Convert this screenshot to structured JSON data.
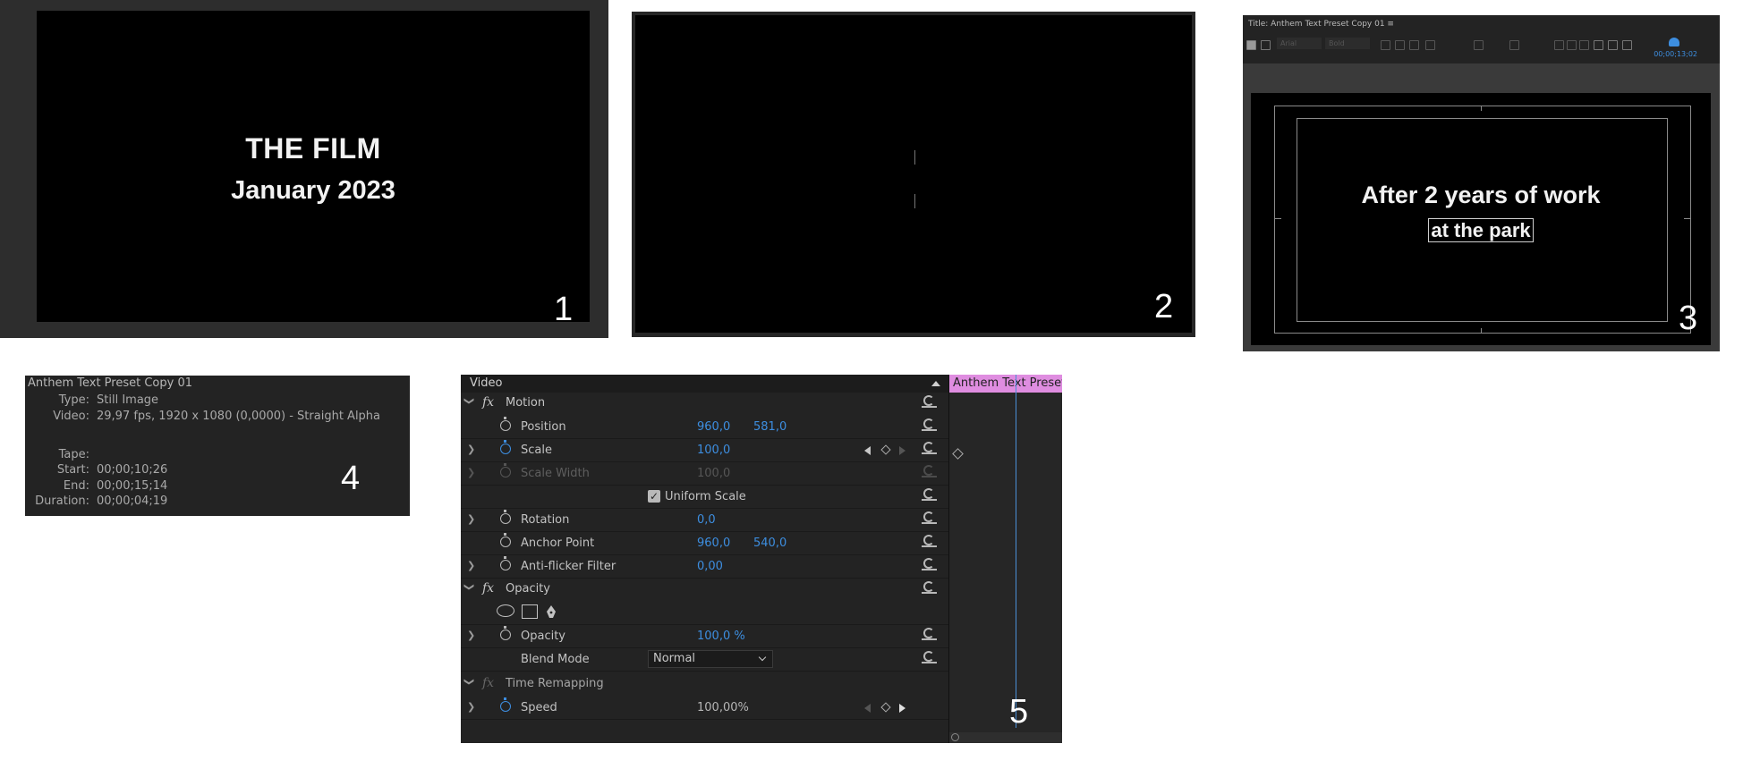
{
  "panel1": {
    "line1": "THE FILM",
    "line2": "January 2023",
    "number": "1"
  },
  "panel2": {
    "number": "2"
  },
  "panel3": {
    "window_title": "Title: Anthem Text Preset Copy 01 ≡",
    "font_field": "Arial",
    "style_field": "Bold",
    "timecode": "00;00;13;02",
    "line1": "After 2 years of work",
    "line2": "at the park",
    "number": "3"
  },
  "panel4": {
    "clip_name": "Anthem Text Preset Copy 01",
    "type_label": "Type:",
    "type_value": "Still Image",
    "video_label": "Video:",
    "video_value": "29,97 fps, 1920 x 1080 (0,0000) - Straight Alpha",
    "tape_label": "Tape:",
    "start_label": "Start:",
    "start_value": "00;00;10;26",
    "end_label": "End:",
    "end_value": "00;00;15;14",
    "duration_label": "Duration:",
    "duration_value": "00;00;04;19",
    "number": "4"
  },
  "panel5": {
    "header": "Video",
    "clip_label": "Anthem Text Preset",
    "number": "5",
    "motion": {
      "name": "Motion",
      "position_label": "Position",
      "position_x": "960,0",
      "position_y": "581,0",
      "scale_label": "Scale",
      "scale_value": "100,0",
      "scale_width_label": "Scale Width",
      "scale_width_value": "100,0",
      "uniform_scale_label": "Uniform Scale",
      "uniform_scale_checked": true,
      "rotation_label": "Rotation",
      "rotation_value": "0,0",
      "anchor_label": "Anchor Point",
      "anchor_x": "960,0",
      "anchor_y": "540,0",
      "antiflicker_label": "Anti-flicker Filter",
      "antiflicker_value": "0,00"
    },
    "opacity": {
      "name": "Opacity",
      "opacity_label": "Opacity",
      "opacity_value": "100,0 %",
      "blend_label": "Blend Mode",
      "blend_value": "Normal"
    },
    "time_remapping": {
      "name": "Time Remapping",
      "speed_label": "Speed",
      "speed_value": "100,00%"
    }
  }
}
